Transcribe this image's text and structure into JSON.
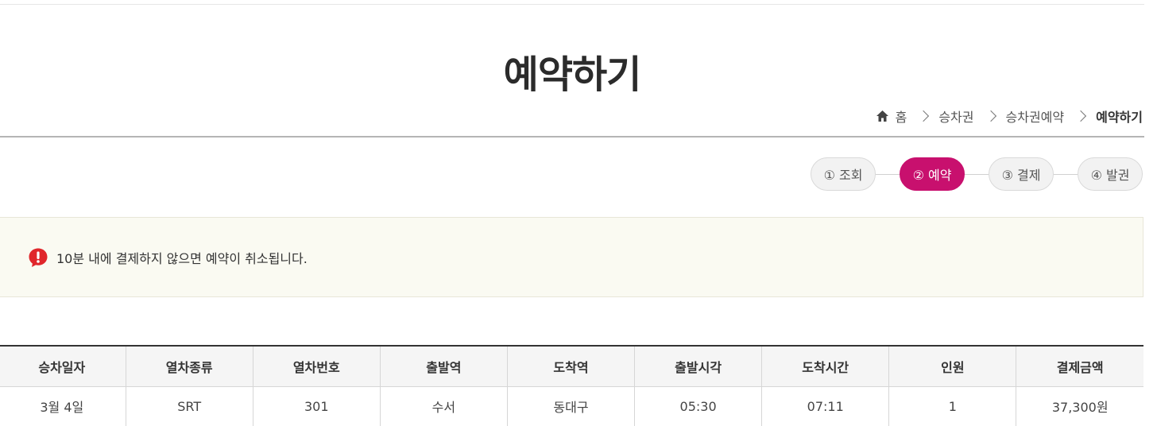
{
  "page": {
    "title": "예약하기"
  },
  "breadcrumb": {
    "items": [
      "홈",
      "승차권",
      "승차권예약",
      "예약하기"
    ]
  },
  "steps": [
    {
      "label": "① 조회",
      "active": false
    },
    {
      "label": "② 예약",
      "active": true
    },
    {
      "label": "③ 결제",
      "active": false
    },
    {
      "label": "④ 발권",
      "active": false
    }
  ],
  "notice": {
    "text": "10분 내에 결제하지 않으면 예약이 취소됩니다.",
    "icon": "alert-icon"
  },
  "reservation_table": {
    "headers": [
      "승차일자",
      "열차종류",
      "열차번호",
      "출발역",
      "도착역",
      "출발시각",
      "도착시간",
      "인원",
      "결제금액"
    ],
    "rows": [
      [
        "3월 4일",
        "SRT",
        "301",
        "수서",
        "동대구",
        "05:30",
        "07:11",
        "1",
        "37,300원"
      ]
    ]
  },
  "colors": {
    "accent": "#c8106e",
    "alert": "#e0262b",
    "notice_bg": "#fafaf2"
  }
}
